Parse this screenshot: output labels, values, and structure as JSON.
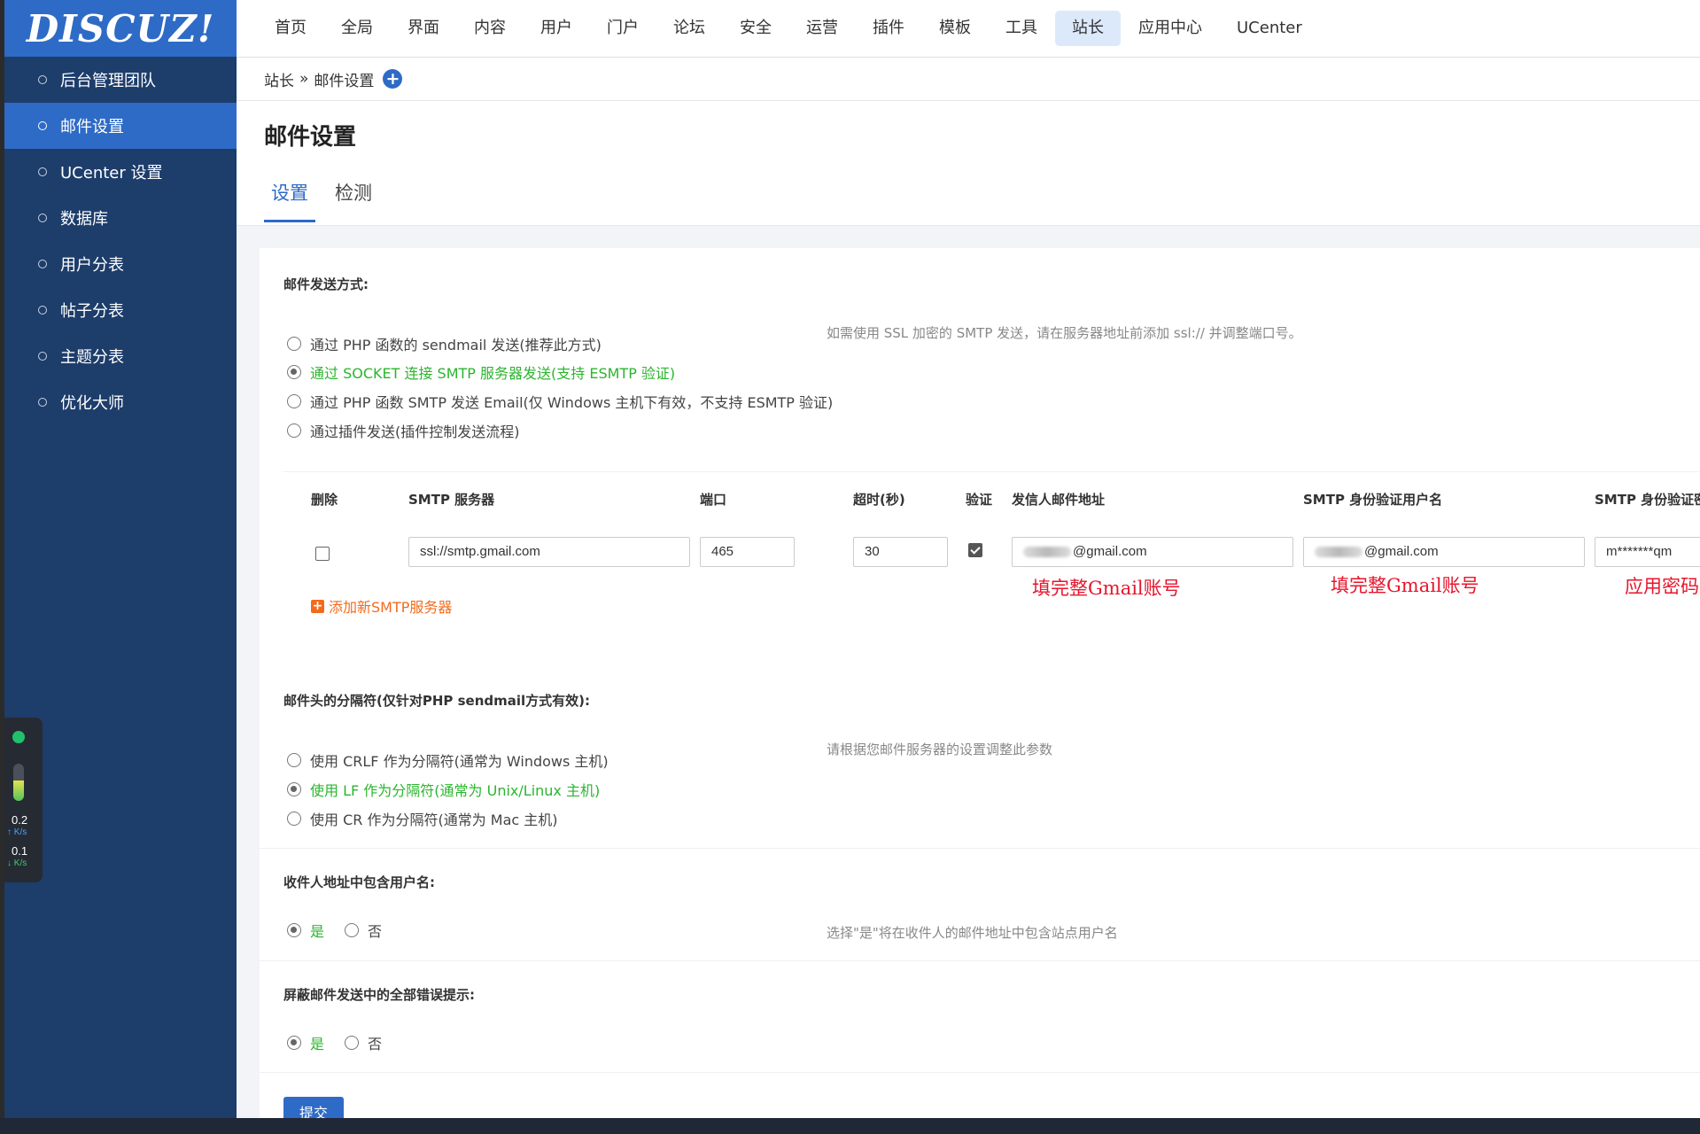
{
  "logo": "DISCUZ!",
  "topnav": [
    "首页",
    "全局",
    "界面",
    "内容",
    "用户",
    "门户",
    "论坛",
    "安全",
    "运营",
    "插件",
    "模板",
    "工具",
    "站长",
    "应用中心",
    "UCenter"
  ],
  "sidebar": [
    "后台管理团队",
    "邮件设置",
    "UCenter 设置",
    "数据库",
    "用户分表",
    "帖子分表",
    "主题分表",
    "优化大师"
  ],
  "speed": {
    "up_value": "0.2",
    "up_unit": "↑ K/s",
    "down_value": "0.1",
    "down_unit": "↓ K/s",
    "level": 0.55
  },
  "breadcrumb": {
    "parent": "站长",
    "sep": "»",
    "current": "邮件设置"
  },
  "page_title": "邮件设置",
  "tabs": [
    "设置",
    "检测"
  ],
  "send_method": {
    "label": "邮件发送方式:",
    "hint": "如需使用 SSL 加密的 SMTP 发送，请在服务器地址前添加 ssl:// 并调整端口号。",
    "options": [
      "通过 PHP 函数的 sendmail 发送(推荐此方式)",
      "通过 SOCKET 连接 SMTP 服务器发送(支持 ESMTP 验证)",
      "通过 PHP 函数 SMTP 发送 Email(仅 Windows 主机下有效，不支持 ESMTP 验证)",
      "通过插件发送(插件控制发送流程)"
    ]
  },
  "smtp_table": {
    "headers": {
      "delete": "删除",
      "server": "SMTP 服务器",
      "port": "端口",
      "timeout": "超时(秒)",
      "auth": "验证",
      "from": "发信人邮件地址",
      "username": "SMTP 身份验证用户名",
      "password": "SMTP 身份验证密码"
    },
    "row": {
      "server": "ssl://smtp.gmail.com",
      "port": "465",
      "timeout": "30",
      "from": "@gmail.com",
      "username": "@gmail.com",
      "password": "m*******qm"
    },
    "add_link": "添加新SMTP服务器",
    "notes": {
      "from": "填完整Gmail账号",
      "username": "填完整Gmail账号",
      "password": "应用密码"
    }
  },
  "separator": {
    "label": "邮件头的分隔符(仅针对PHP sendmail方式有效):",
    "hint": "请根据您邮件服务器的设置调整此参数",
    "options": [
      "使用 CRLF 作为分隔符(通常为 Windows 主机)",
      "使用 LF 作为分隔符(通常为 Unix/Linux 主机)",
      "使用 CR 作为分隔符(通常为 Mac 主机)"
    ]
  },
  "include_username": {
    "label": "收件人地址中包含用户名:",
    "yes": "是",
    "no": "否",
    "hint": "选择\"是\"将在收件人的邮件地址中包含站点用户名"
  },
  "mute_errors": {
    "label": "屏蔽邮件发送中的全部错误提示:",
    "yes": "是",
    "no": "否"
  },
  "submit": "提交",
  "colors": {
    "brand": "#2e6bc6",
    "sidebar": "#1d3d6b",
    "selected": "#2bb52e",
    "note": "#e6162d",
    "link": "#f26b1d"
  }
}
